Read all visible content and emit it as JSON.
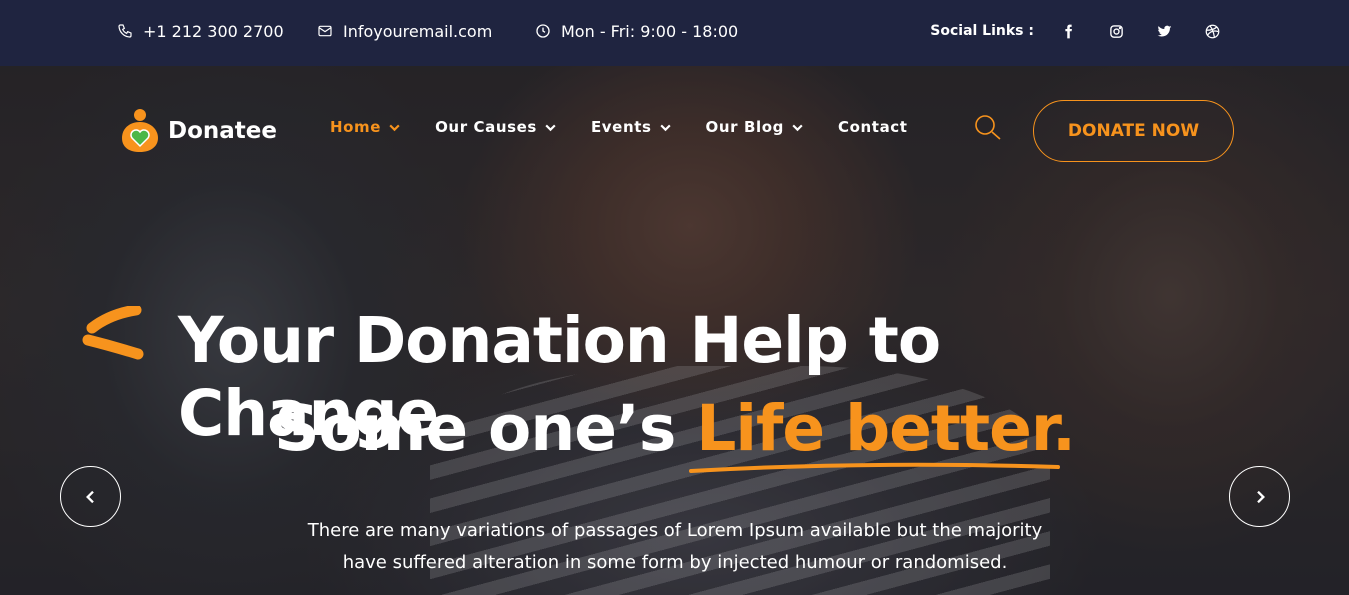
{
  "topbar": {
    "phone": "+1 212 300 2700",
    "email": "Infoyouremail.com",
    "hours": "Mon - Fri: 9:00 - 18:00",
    "social_label": "Social Links :",
    "social_icons": [
      "facebook-icon",
      "instagram-icon",
      "twitter-icon",
      "dribbble-icon"
    ]
  },
  "brand": {
    "name": "Donatee"
  },
  "nav": {
    "items": [
      {
        "label": "Home",
        "active": true
      },
      {
        "label": "Our Causes"
      },
      {
        "label": "Events"
      },
      {
        "label": "Our Blog"
      },
      {
        "label": "Contact"
      }
    ],
    "donate_label": "DONATE NOW"
  },
  "hero": {
    "line1": "Your Donation Help to Change",
    "line2_prefix": "Some one’s ",
    "line2_highlight": "Life better.",
    "subtext": "There are many variations of passages of Lorem Ipsum available but the majority have suffered alteration in some form by injected humour or randomised."
  },
  "colors": {
    "accent": "#f7931d",
    "topbar_bg": "#1f2440",
    "green": "#4cb748"
  }
}
